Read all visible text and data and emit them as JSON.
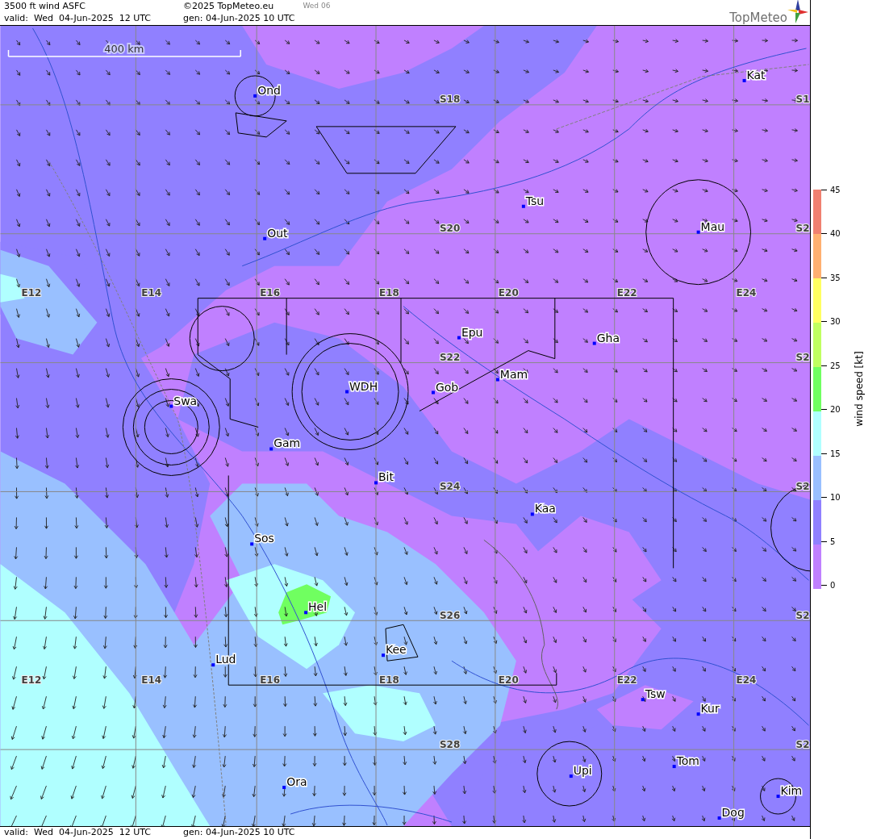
{
  "header": {
    "title": "3500 ft wind ASFC",
    "copyright": "©2025 TopMeteo.eu",
    "day": "Wed 06",
    "valid": "valid:  Wed  04-Jun-2025  12 UTC",
    "generated": "gen: 04-Jun-2025 10 UTC",
    "logo": "TopMeteo"
  },
  "map": {
    "scale": "400 km",
    "places": [
      {
        "name": "Ond"
      },
      {
        "name": "Kat"
      },
      {
        "name": "Tsu"
      },
      {
        "name": "Mau"
      },
      {
        "name": "Out"
      },
      {
        "name": "Epu"
      },
      {
        "name": "Gha"
      },
      {
        "name": "Mam"
      },
      {
        "name": "Gob"
      },
      {
        "name": "WDH"
      },
      {
        "name": "Swa"
      },
      {
        "name": "Gam"
      },
      {
        "name": "Bit"
      },
      {
        "name": "Kaa"
      },
      {
        "name": "Sos"
      },
      {
        "name": "Hel"
      },
      {
        "name": "Lud"
      },
      {
        "name": "Kee"
      },
      {
        "name": "Tsw"
      },
      {
        "name": "Kur"
      },
      {
        "name": "Tom"
      },
      {
        "name": "Upi"
      },
      {
        "name": "Ora"
      },
      {
        "name": "Kim"
      },
      {
        "name": "Dog"
      }
    ],
    "longitude_labels": [
      "E12",
      "E14",
      "E16",
      "E18",
      "E20",
      "E22",
      "E24",
      "E12",
      "E14",
      "E16",
      "E18",
      "E20",
      "E22",
      "E24"
    ],
    "latitude_labels": [
      "S18",
      "S20",
      "S22",
      "S24",
      "S26",
      "S28",
      "S1",
      "S2",
      "S2",
      "S2",
      "S2",
      "S2"
    ]
  },
  "legend": {
    "title": "wind speed [kt]",
    "ticks": [
      "45",
      "40",
      "35",
      "30",
      "25",
      "20",
      "15",
      "10",
      "5",
      "0"
    ],
    "bands": [
      {
        "color": "#f08070"
      },
      {
        "color": "#ffb070"
      },
      {
        "color": "#ffff60"
      },
      {
        "color": "#c0ff60"
      },
      {
        "color": "#70ff60"
      },
      {
        "color": "#b0ffff"
      },
      {
        "color": "#99c0ff"
      },
      {
        "color": "#9080ff"
      },
      {
        "color": "#c080ff"
      }
    ]
  },
  "footer": {
    "valid": "valid:  Wed  04-Jun-2025  12 UTC",
    "generated": "gen: 04-Jun-2025 10 UTC"
  }
}
